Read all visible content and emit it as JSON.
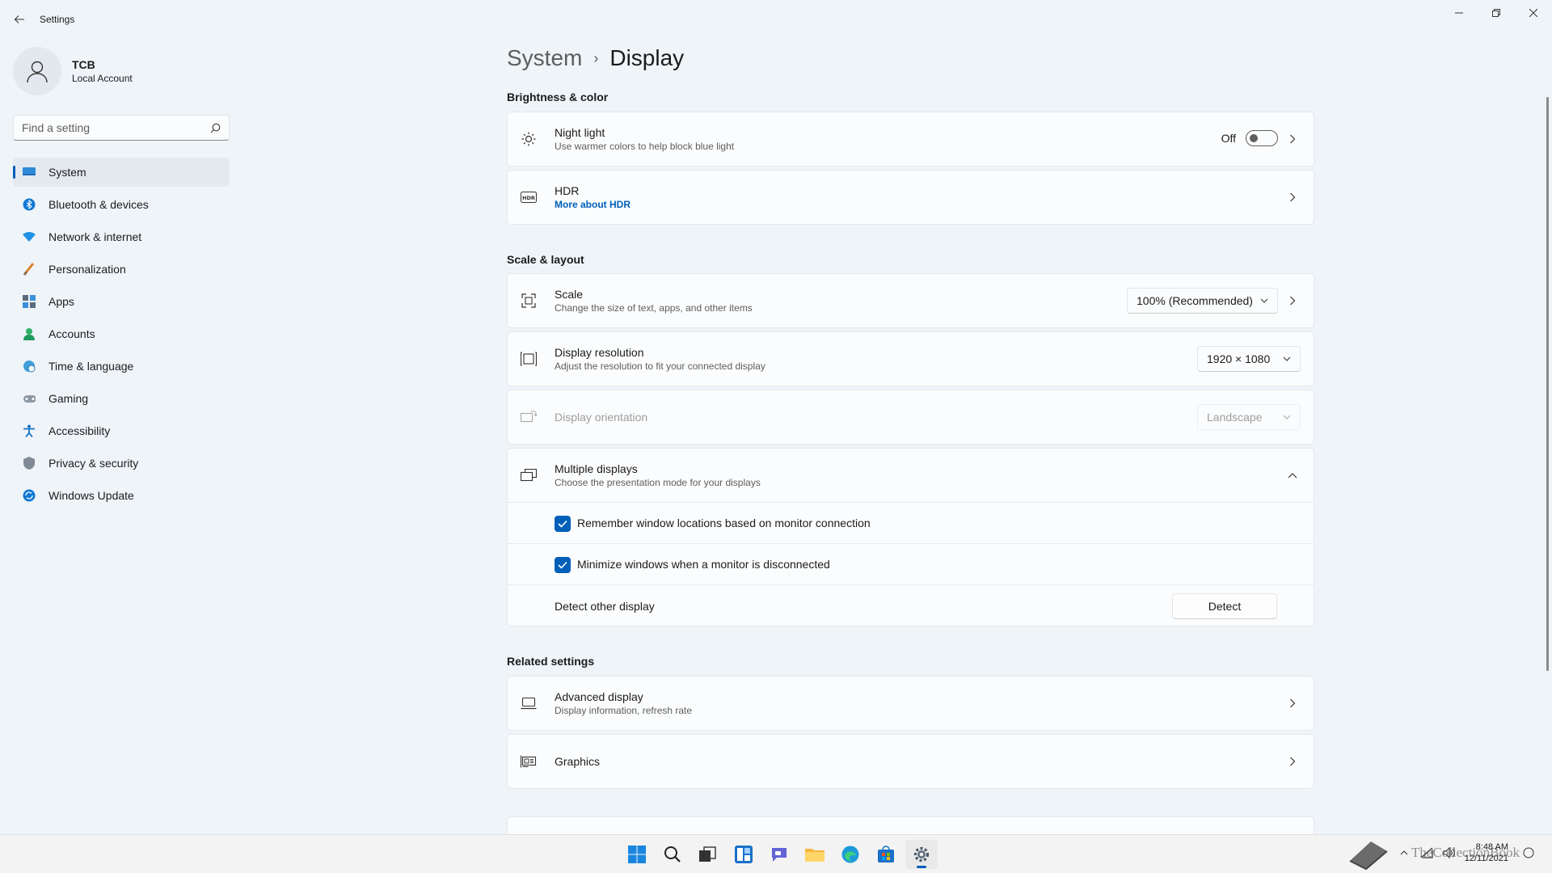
{
  "window": {
    "title": "Settings"
  },
  "profile": {
    "name": "TCB",
    "account_type": "Local Account"
  },
  "search": {
    "placeholder": "Find a setting"
  },
  "nav": [
    {
      "label": "System",
      "icon": "monitor-icon",
      "active": true
    },
    {
      "label": "Bluetooth & devices",
      "icon": "bluetooth-icon"
    },
    {
      "label": "Network & internet",
      "icon": "wifi-icon"
    },
    {
      "label": "Personalization",
      "icon": "brush-icon"
    },
    {
      "label": "Apps",
      "icon": "apps-icon"
    },
    {
      "label": "Accounts",
      "icon": "person-icon"
    },
    {
      "label": "Time & language",
      "icon": "globe-clock-icon"
    },
    {
      "label": "Gaming",
      "icon": "gamepad-icon"
    },
    {
      "label": "Accessibility",
      "icon": "accessibility-icon"
    },
    {
      "label": "Privacy & security",
      "icon": "shield-icon"
    },
    {
      "label": "Windows Update",
      "icon": "update-icon"
    }
  ],
  "breadcrumb": {
    "parent": "System",
    "separator": "›",
    "current": "Display"
  },
  "sections": {
    "brightness": "Brightness & color",
    "scale_layout": "Scale & layout",
    "related": "Related settings"
  },
  "night_light": {
    "title": "Night light",
    "subtitle": "Use warmer colors to help block blue light",
    "state_label": "Off"
  },
  "hdr": {
    "title": "HDR",
    "link": "More about HDR"
  },
  "scale": {
    "title": "Scale",
    "subtitle": "Change the size of text, apps, and other items",
    "value": "100% (Recommended)"
  },
  "resolution": {
    "title": "Display resolution",
    "subtitle": "Adjust the resolution to fit your connected display",
    "value": "1920 × 1080"
  },
  "orientation": {
    "title": "Display orientation",
    "value": "Landscape"
  },
  "multiple_displays": {
    "title": "Multiple displays",
    "subtitle": "Choose the presentation mode for your displays",
    "remember_label": "Remember window locations based on monitor connection",
    "minimize_label": "Minimize windows when a monitor is disconnected",
    "detect_label": "Detect other display",
    "detect_button": "Detect"
  },
  "advanced_display": {
    "title": "Advanced display",
    "subtitle": "Display information, refresh rate"
  },
  "graphics": {
    "title": "Graphics"
  },
  "taskbar": {
    "time": "8:48 AM",
    "date": "12/11/2021",
    "watermark": "TheCollectionBook"
  },
  "colors": {
    "accent": "#005fb8",
    "background": "#eff4f9",
    "card": "#fbfcfd"
  }
}
